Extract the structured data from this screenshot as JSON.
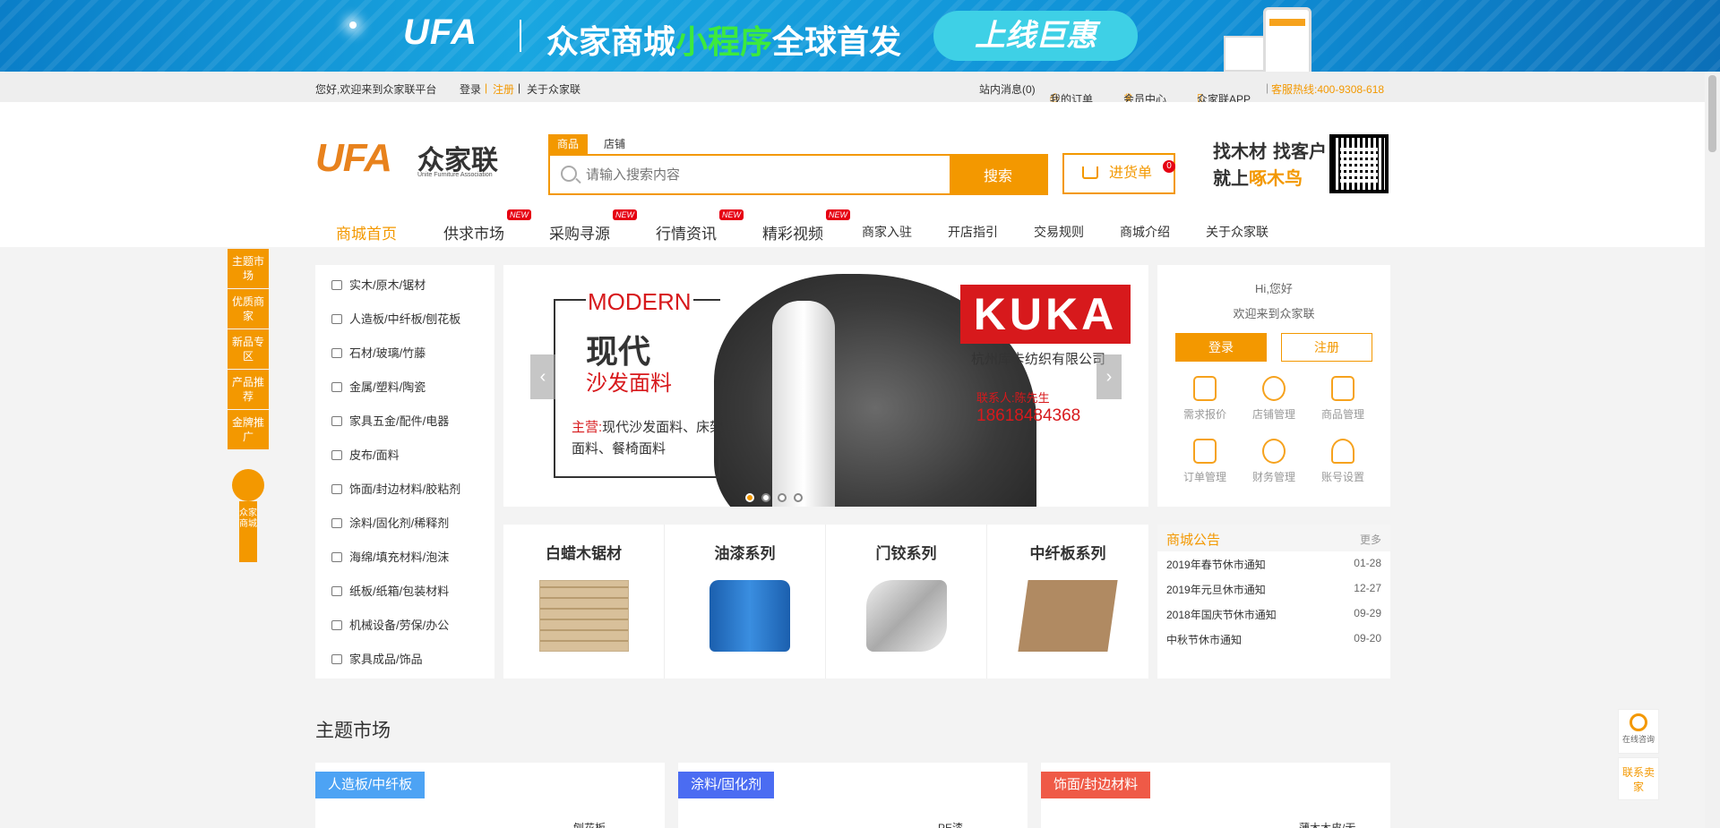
{
  "banner": {
    "logo": "UFA",
    "title_a": "众家商城",
    "title_b": "小程序",
    "title_c": "全球首发",
    "pill": "上线巨惠"
  },
  "topbar": {
    "welcome": "您好,欢迎来到众家联平台",
    "login": "登录",
    "sep1": "|",
    "register": "注册",
    "sep2": "|",
    "about": "关于众家联",
    "messages": "站内消息(0)",
    "orders": "我的订单",
    "member": "会员中心",
    "app": "众家联APP",
    "hotline": "客服热线:400-9308-618"
  },
  "header": {
    "logo_text": "UFA",
    "logo_cn": "众家联",
    "logo_en": "Unite Furniture Association",
    "tab_goods": "商品",
    "tab_shop": "店铺",
    "search_placeholder": "请输入搜索内容",
    "search_button": "搜索",
    "cart_label": "进货单",
    "cart_count": "0",
    "slogan_line1": "找木材 找客户",
    "slogan_line2a": "就上",
    "slogan_line2b": "啄木鸟"
  },
  "nav": {
    "items": [
      {
        "label": "商城首页"
      },
      {
        "label": "供求市场",
        "badge": "NEW"
      },
      {
        "label": "采购寻源",
        "badge": "NEW"
      },
      {
        "label": "行情资讯",
        "badge": "NEW"
      },
      {
        "label": "精彩视频",
        "badge": "NEW"
      },
      {
        "label": "商家入驻"
      },
      {
        "label": "开店指引"
      },
      {
        "label": "交易规则"
      },
      {
        "label": "商城介绍"
      },
      {
        "label": "关于众家联"
      }
    ]
  },
  "sidefloat": {
    "items": [
      "主题市场",
      "优质商家",
      "新品专区",
      "产品推荐",
      "金牌推广"
    ],
    "tag": "众家商城"
  },
  "categories": [
    "实木/原木/锯材",
    "人造板/中纤板/刨花板",
    "石材/玻璃/竹藤",
    "金属/塑料/陶瓷",
    "家具五金/配件/电器",
    "皮布/面料",
    "饰面/封边材料/胶粘剂",
    "涂料/固化剂/稀释剂",
    "海绵/填充材料/泡沫",
    "纸板/纸箱/包装材料",
    "机械设备/劳保/办公",
    "家具成品/饰品"
  ],
  "carousel": {
    "modern": "MODERN",
    "cn1": "现代",
    "cn2": "沙发面料",
    "main_label": "主营:",
    "main_text": "现代沙发面料、床架面料、餐椅面料",
    "brand": "KUKA",
    "company": "杭州库卡纺织有限公司",
    "contact": "联系人:陈先生",
    "phone": "18618484368",
    "prev": "‹",
    "next": "›"
  },
  "user": {
    "hi": "Hi,您好",
    "welcome": "欢迎来到众家联",
    "login": "登录",
    "register": "注册",
    "icons": [
      "需求报价",
      "店铺管理",
      "商品管理",
      "订单管理",
      "财务管理",
      "账号设置"
    ]
  },
  "products": [
    "白蜡木锯材",
    "油漆系列",
    "门铰系列",
    "中纤板系列"
  ],
  "notice": {
    "title": "商城公告",
    "more": "更多",
    "items": [
      {
        "text": "2019年春节休市通知",
        "date": "01-28"
      },
      {
        "text": "2019年元旦休市通知",
        "date": "12-27"
      },
      {
        "text": "2018年国庆节休市通知",
        "date": "09-29"
      },
      {
        "text": "中秋节休市通知",
        "date": "09-20"
      }
    ]
  },
  "section": {
    "title": "主题市场",
    "markets": [
      {
        "label": "人造板/中纤板",
        "sub": "刨花板",
        "color": "#4da3f4"
      },
      {
        "label": "涂料/固化剂",
        "sub": "PE漆",
        "color": "#4b6cf2"
      },
      {
        "label": "饰面/封边材料",
        "sub": "薄木木皮/无",
        "color": "#ef5a47"
      }
    ]
  },
  "float_right": {
    "consult": "在线咨询",
    "contact": "联系卖家"
  },
  "colors": {
    "accent": "#f39800",
    "red": "#e60012"
  }
}
